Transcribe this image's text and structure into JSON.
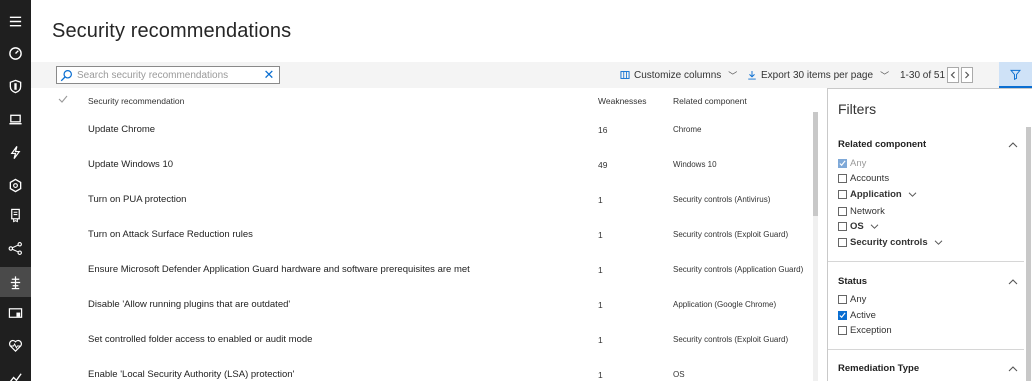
{
  "page": {
    "title": "Security recommendations"
  },
  "nav": {
    "items": [
      {
        "icon": "hamburger-menu-icon"
      },
      {
        "icon": "dashboard-gauge-icon"
      },
      {
        "icon": "shield-icon"
      },
      {
        "icon": "laptop-icon"
      },
      {
        "icon": "lightning-icon"
      },
      {
        "icon": "hexagon-icon"
      },
      {
        "icon": "document-badge-icon"
      },
      {
        "icon": "network-share-icon"
      },
      {
        "icon": "threat-management-icon",
        "active": true
      },
      {
        "icon": "device-screen-icon"
      },
      {
        "icon": "heart-pulse-icon"
      },
      {
        "icon": "chart-line-icon"
      }
    ]
  },
  "toolbar": {
    "search_placeholder": "Search security recommendations",
    "customize_label": "Customize columns",
    "export_label": "Export",
    "per_page_label": "30 items per page",
    "pager_label": "1-30 of 51"
  },
  "table": {
    "columns": [
      "Security recommendation",
      "Weaknesses",
      "Related component"
    ],
    "rows": [
      {
        "recommendation": "Update Chrome",
        "weaknesses": "16",
        "component": "Chrome"
      },
      {
        "recommendation": "Update Windows 10",
        "weaknesses": "49",
        "component": "Windows 10"
      },
      {
        "recommendation": "Turn on PUA protection",
        "weaknesses": "1",
        "component": "Security controls (Antivirus)"
      },
      {
        "recommendation": "Turn on Attack Surface Reduction rules",
        "weaknesses": "1",
        "component": "Security controls (Exploit Guard)"
      },
      {
        "recommendation": "Ensure Microsoft Defender Application Guard hardware and software prerequisites are met",
        "weaknesses": "1",
        "component": "Security controls (Application Guard)"
      },
      {
        "recommendation": "Disable 'Allow running plugins that are outdated'",
        "weaknesses": "1",
        "component": "Application (Google Chrome)"
      },
      {
        "recommendation": "Set controlled folder access to enabled or audit mode",
        "weaknesses": "1",
        "component": "Security controls (Exploit Guard)"
      },
      {
        "recommendation": "Enable 'Local Security Authority (LSA) protection'",
        "weaknesses": "1",
        "component": "OS"
      }
    ]
  },
  "filters": {
    "title": "Filters",
    "related_component": {
      "title": "Related component",
      "options": [
        {
          "label": "Any",
          "checked": true,
          "muted": true
        },
        {
          "label": "Accounts",
          "checked": false
        },
        {
          "label": "Application",
          "checked": false,
          "expandable": true
        },
        {
          "label": "Network",
          "checked": false
        },
        {
          "label": "OS",
          "checked": false,
          "expandable": true
        },
        {
          "label": "Security controls",
          "checked": false,
          "expandable": true
        }
      ]
    },
    "status": {
      "title": "Status",
      "options": [
        {
          "label": "Any",
          "checked": false
        },
        {
          "label": "Active",
          "checked": true
        },
        {
          "label": "Exception",
          "checked": false
        }
      ]
    },
    "remediation_type": {
      "title": "Remediation Type"
    }
  },
  "colors": {
    "rail_bg": "#1f1f1f",
    "accent": "#0a6ed1",
    "toolbar_bg": "#f4f4f4",
    "filter_active_bg": "#cfe2f7"
  }
}
